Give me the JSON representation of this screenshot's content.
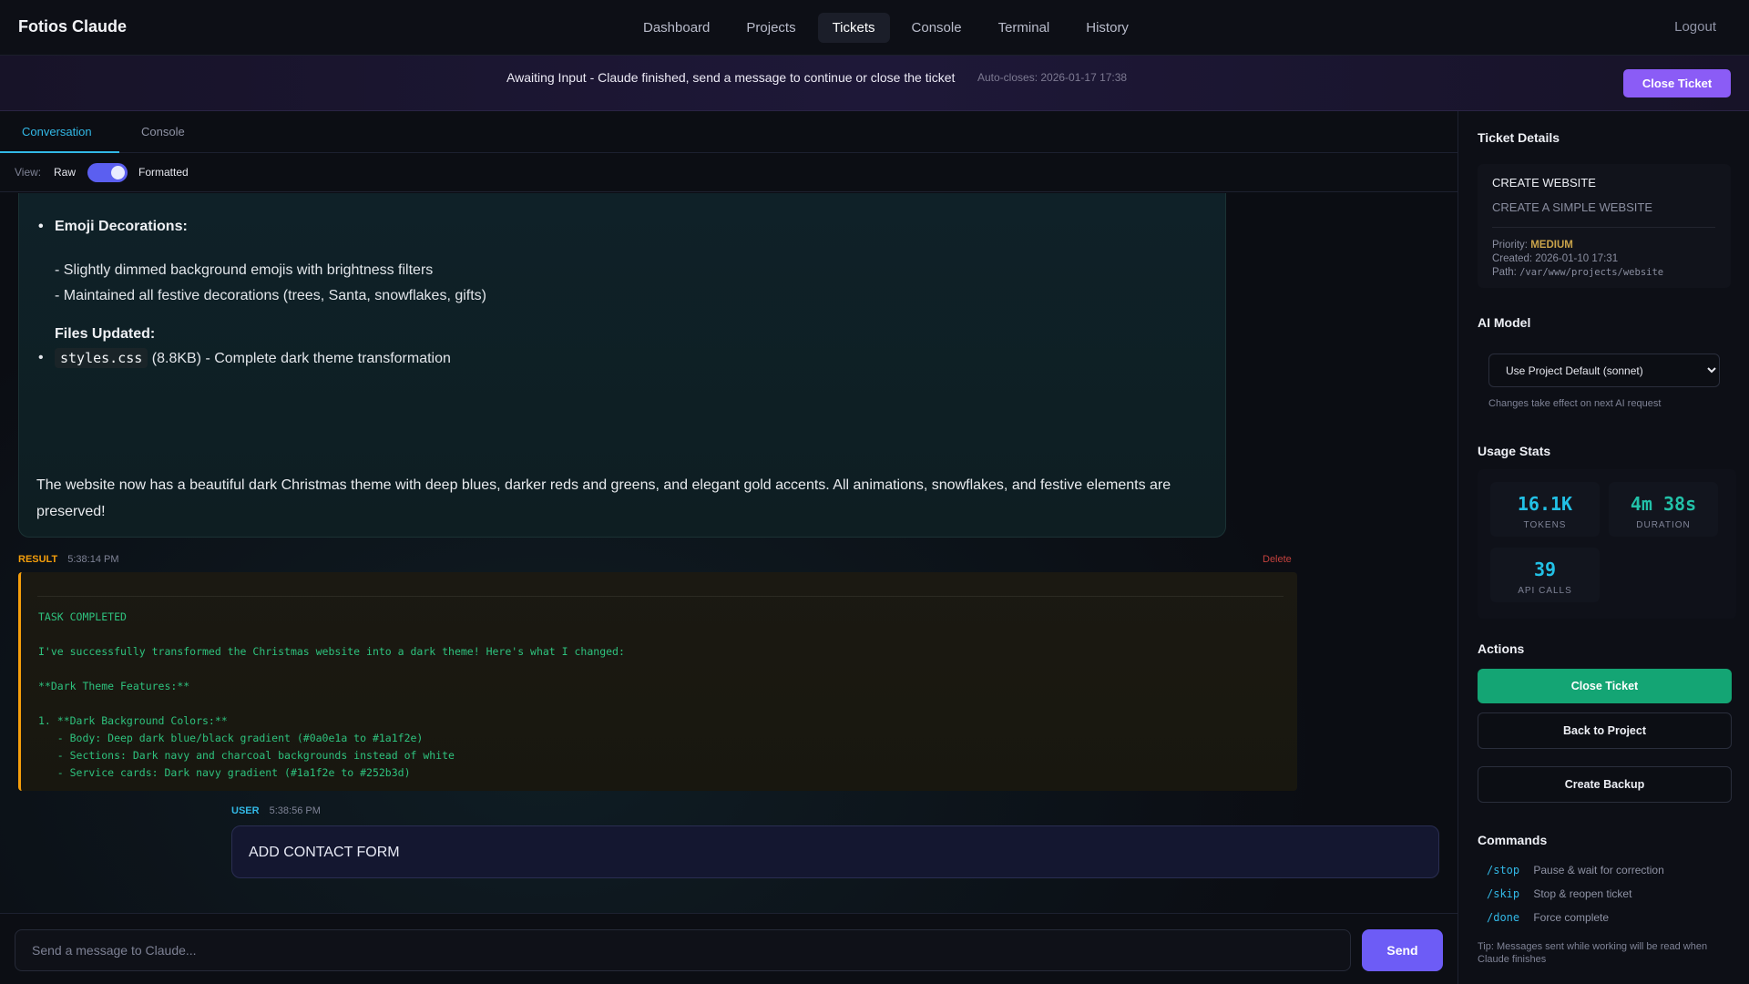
{
  "app": {
    "brand": "Fotios Claude",
    "nav": [
      "Dashboard",
      "Projects",
      "Tickets",
      "Console",
      "Terminal",
      "History"
    ],
    "logout": "Logout"
  },
  "banner": {
    "text": "Awaiting Input - Claude finished, send a message to continue or close the ticket",
    "auto_closes": "Auto-closes: 2026-01-17 17:38",
    "close_label": "Close Ticket"
  },
  "tabs": [
    "Conversation",
    "Console"
  ],
  "view": {
    "label": "View:",
    "raw": "Raw",
    "formatted": "Formatted",
    "formatted_on": true
  },
  "assistant": {
    "heading": "Emoji Decorations:",
    "lines": [
      "- Slightly dimmed background emojis with brightness filters",
      "- Maintained all festive decorations (trees, Santa, snowflakes, gifts)"
    ],
    "files_heading": "Files Updated:",
    "file_name": "styles.css",
    "file_desc": "(8.8KB) - Complete dark theme transformation",
    "summary": "The website now has a beautiful dark Christmas theme with deep blues, darker reds and greens, and elegant gold accents. All animations, snowflakes, and festive elements are preserved!"
  },
  "result": {
    "tag": "RESULT",
    "time": "5:38:14 PM",
    "delete": "Delete",
    "body": "TASK COMPLETED\n\nI've successfully transformed the Christmas website into a dark theme! Here's what I changed:\n\n**Dark Theme Features:**\n\n1. **Dark Background Colors:**\n   - Body: Deep dark blue/black gradient (#0a0e1a to #1a1f2e)\n   - Sections: Dark navy and charcoal backgrounds instead of white\n   - Service cards: Dark navy gradient (#1a1f2e to #252b3d)"
  },
  "user_msg": {
    "tag": "USER",
    "time": "5:38:56 PM",
    "text": "ADD CONTACT FORM"
  },
  "composer": {
    "placeholder": "Send a message to Claude...",
    "send": "Send"
  },
  "sidebar": {
    "details_heading": "Ticket Details",
    "ticket_title": "CREATE WEBSITE",
    "ticket_subtitle": "CREATE A SIMPLE WEBSITE",
    "priority_label": "Priority:",
    "priority": "MEDIUM",
    "created": "Created: 2026-01-10 17:31",
    "path_label": "Path:",
    "path": "/var/www/projects/website",
    "model_heading": "AI Model",
    "model_selected": "Use Project Default (sonnet)",
    "model_note": "Changes take effect on next AI request",
    "stats_heading": "Usage Stats",
    "stats": [
      {
        "value": "16.1K",
        "label": "TOKENS",
        "color": "#22c1e6"
      },
      {
        "value": "4m 38s",
        "label": "DURATION",
        "color": "#22c1a8"
      },
      {
        "value": "39",
        "label": "API CALLS",
        "color": "#22c1e6"
      }
    ],
    "actions_heading": "Actions",
    "actions": [
      "Close Ticket",
      "Back to Project",
      "Create Backup"
    ],
    "commands_heading": "Commands",
    "commands": [
      {
        "cmd": "/stop",
        "desc": "Pause & wait for correction"
      },
      {
        "cmd": "/skip",
        "desc": "Stop & reopen ticket"
      },
      {
        "cmd": "/done",
        "desc": "Force complete"
      }
    ],
    "tip": "Tip: Messages sent while working will be read when Claude finishes"
  }
}
